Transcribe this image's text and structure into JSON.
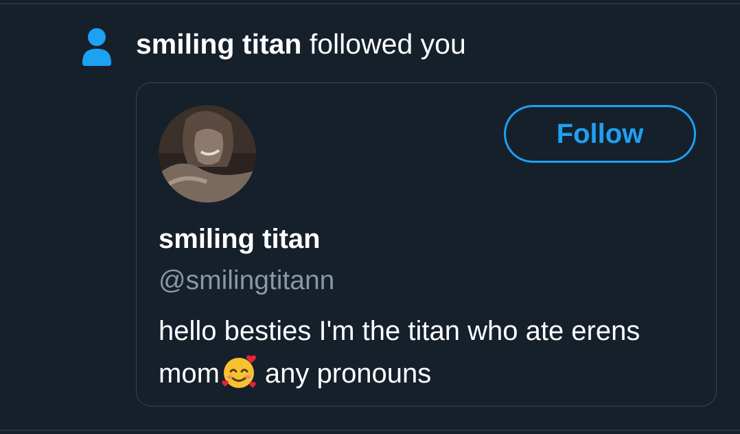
{
  "notification": {
    "user": "smiling titan",
    "action": " followed you"
  },
  "card": {
    "follow_label": "Follow",
    "display_name": "smiling titan",
    "handle": "@smilingtitann",
    "bio_before": "hello besties I'm the titan who ate erens mom",
    "bio_after": "any pronouns"
  },
  "icons": {
    "notification": "person-icon",
    "bio_emoji": "smiling-face-with-hearts-emoji"
  },
  "colors": {
    "background": "#15202b",
    "accent": "#1da1f2",
    "text": "#ffffff",
    "muted": "#8899a6",
    "border": "#38444d"
  }
}
